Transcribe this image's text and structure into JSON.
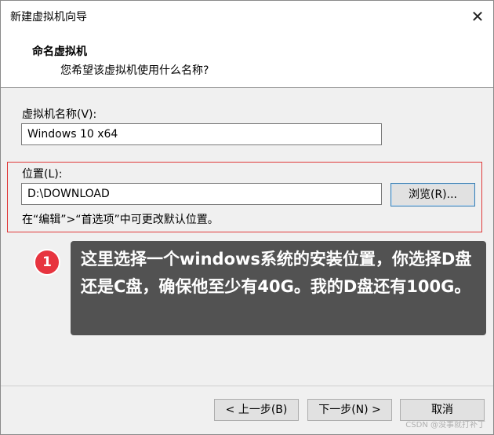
{
  "window": {
    "title": "新建虚拟机向导",
    "close_glyph": "✕"
  },
  "header": {
    "title": "命名虚拟机",
    "subtitle": "您希望该虚拟机使用什么名称?"
  },
  "name_field": {
    "label": "虚拟机名称(V):",
    "value": "Windows 10 x64"
  },
  "location_field": {
    "label": "位置(L):",
    "value": "D:\\DOWNLOAD",
    "browse_label": "浏览(R)...",
    "hint": "在“编辑”>“首选项”中可更改默认位置。"
  },
  "callout": {
    "number": "1",
    "text": "这里选择一个windows系统的安装位置，你选择D盘还是C盘，确保他至少有40G。我的D盘还有100G。"
  },
  "footer": {
    "back_label": "< 上一步(B)",
    "next_label": "下一步(N) >",
    "cancel_label": "取消"
  },
  "watermark": "CSDN @没事就打补丁",
  "colors": {
    "highlight_border": "#e03a3a",
    "callout_bg": "#525252",
    "badge_bg": "#e7343f"
  }
}
